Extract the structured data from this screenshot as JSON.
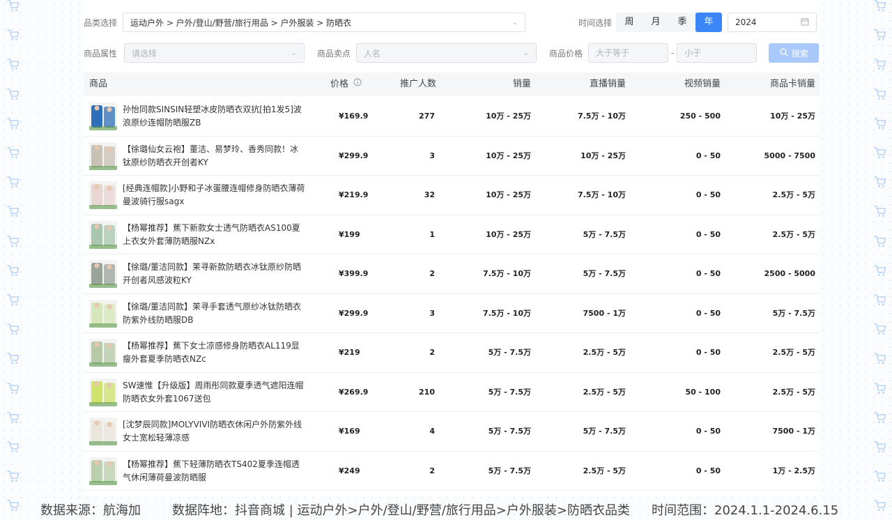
{
  "filters": {
    "category_label": "品类选择",
    "category_value": "运动户外 > 户外/登山/野营/旅行用品 > 户外服装 > 防晒衣",
    "time_label": "时间选择",
    "time_options": [
      "周",
      "月",
      "季",
      "年"
    ],
    "time_active": "年",
    "year_value": "2024",
    "attr_label": "商品属性",
    "attr_placeholder": "请选择",
    "selling_label": "商品卖点",
    "selling_placeholder": "人名",
    "price_label": "商品价格",
    "price_min_placeholder": "大于等于",
    "price_sep": "-",
    "price_max_placeholder": "小于",
    "search_label": "搜索"
  },
  "table": {
    "headers": {
      "product": "商品",
      "price": "价格",
      "promoters": "推广人数",
      "sales": "销量",
      "live_sales": "直播销量",
      "video_sales": "视频销量",
      "card_sales": "商品卡销量"
    },
    "rows": [
      {
        "name": "孙怡同款SINSIN轻塑冰皮防晒衣双抗[拍1发5]波浪原纱连帽防晒服ZB",
        "price": "¥169.9",
        "promoters": "277",
        "sales": "10万 - 25万",
        "live": "7.5万 - 10万",
        "video": "250 - 500",
        "card": "10万 - 25万",
        "thumb_color": "#2d6fb8"
      },
      {
        "name": "【徐璐仙女云袍】董洁、易梦玲、香秀同款！冰钛原纱防晒衣开创者KY",
        "price": "¥299.9",
        "promoters": "3",
        "sales": "10万 - 25万",
        "live": "10万 - 25万",
        "video": "0 - 50",
        "card": "5000 - 7500",
        "thumb_color": "#c8c2b6"
      },
      {
        "name": "[经典连帽款]小野和子冰蛋腰连帽修身防晒衣薄荷曼波骑行服sagx",
        "price": "¥219.9",
        "promoters": "32",
        "sales": "10万 - 25万",
        "live": "7.5万 - 10万",
        "video": "0 - 50",
        "card": "2.5万 - 5万",
        "thumb_color": "#e8d6d3"
      },
      {
        "name": "【杨幂推荐】蕉下新款女士透气防晒衣AS100夏上衣女外套薄防晒服NZx",
        "price": "¥199",
        "promoters": "1",
        "sales": "10万 - 25万",
        "live": "5万 - 7.5万",
        "video": "0 - 50",
        "card": "2.5万 - 5万",
        "thumb_color": "#a9c7b0"
      },
      {
        "name": "【徐璐/董洁同款】茉寻新款防晒衣冰钛原纱防晒开创者风感波粒KY",
        "price": "¥399.9",
        "promoters": "2",
        "sales": "7.5万 - 10万",
        "live": "5万 - 7.5万",
        "video": "0 - 50",
        "card": "2500 - 5000",
        "thumb_color": "#9aa39a"
      },
      {
        "name": "【徐璐/董洁同款】茉寻手套透气原纱冰钛防晒衣防紫外线防晒服DB",
        "price": "¥299.9",
        "promoters": "3",
        "sales": "7.5万 - 10万",
        "live": "7500 - 1万",
        "video": "0 - 50",
        "card": "5万 - 7.5万",
        "thumb_color": "#d5e7b8"
      },
      {
        "name": "【杨幂推荐】蕉下女士凉感修身防晒衣AL119显瘦外套夏季防晒衣NZc",
        "price": "¥219",
        "promoters": "2",
        "sales": "5万 - 7.5万",
        "live": "2.5万 - 5万",
        "video": "0 - 50",
        "card": "2.5万 - 5万",
        "thumb_color": "#b6c9a6"
      },
      {
        "name": "SW速惟【升级版】周雨彤同款夏季透气遮阳连帽防晒衣女外套1067送包",
        "price": "¥269.9",
        "promoters": "210",
        "sales": "5万 - 7.5万",
        "live": "2.5万 - 5万",
        "video": "50 - 100",
        "card": "2.5万 - 5万",
        "thumb_color": "#cfe36c"
      },
      {
        "name": "[沈梦辰同款]MOLYVIVI防晒衣休闲户外防紫外线女士宽松轻薄凉感",
        "price": "¥169",
        "promoters": "4",
        "sales": "5万 - 7.5万",
        "live": "5万 - 7.5万",
        "video": "0 - 50",
        "card": "7500 - 1万",
        "thumb_color": "#e9e6dc"
      },
      {
        "name": "【杨幂推荐】蕉下轻薄防晒衣TS402夏季连帽透气休闲薄荷曼波防晒服",
        "price": "¥249",
        "promoters": "2",
        "sales": "5万 - 7.5万",
        "live": "2.5万 - 5万",
        "video": "0 - 50",
        "card": "1万 - 2.5万",
        "thumb_color": "#b9cfae"
      }
    ]
  },
  "footer": {
    "source": "数据来源：航海加",
    "scope": "数据阵地：抖音商城 | 运动户外>户外/登山/野营/旅行用品>户外服装>防晒衣品类",
    "period": "时间范围：2024.1.1-2024.6.15"
  },
  "colors": {
    "accent": "#3a86f6",
    "search_disabled": "#a9c8fb",
    "cart_icon": "#b9d3f5"
  },
  "icons": [
    "cart-icon",
    "info-icon",
    "calendar-icon",
    "chevron-down-icon",
    "search-icon"
  ]
}
